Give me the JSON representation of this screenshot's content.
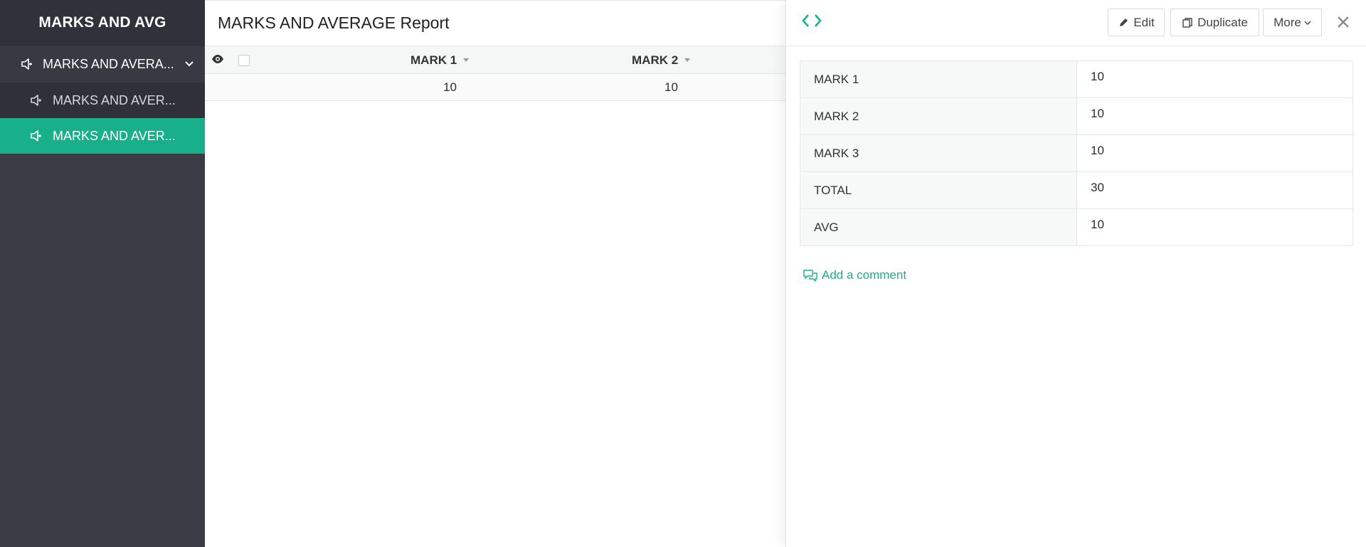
{
  "app": {
    "title": "MARKS AND AVG"
  },
  "sidebar": {
    "group": {
      "label": "MARKS AND AVERA..."
    },
    "items": [
      {
        "label": "MARKS AND AVER...",
        "active": false
      },
      {
        "label": "MARKS AND AVER...",
        "active": true
      }
    ]
  },
  "report": {
    "title": "MARKS AND AVERAGE Report",
    "columns": [
      "MARK 1",
      "MARK 2"
    ],
    "rows": [
      [
        "10",
        "10"
      ]
    ]
  },
  "detail": {
    "buttons": {
      "edit": "Edit",
      "duplicate": "Duplicate",
      "more": "More"
    },
    "fields": [
      {
        "label": "MARK 1",
        "value": "10"
      },
      {
        "label": "MARK 2",
        "value": "10"
      },
      {
        "label": "MARK 3",
        "value": "10"
      },
      {
        "label": "TOTAL",
        "value": "30"
      },
      {
        "label": "AVG",
        "value": "10"
      }
    ],
    "add_comment": "Add a comment"
  },
  "colors": {
    "accent": "#17b08a",
    "sidebar_bg": "#3a3b44",
    "sidebar_title_bg": "#30313a",
    "sidebar_item_bg": "#2f3038"
  },
  "icons": {
    "nav": "speaker-icon",
    "group_toggle": "chevron-down-icon",
    "grid_view": "eye-icon",
    "record_nav": "prev-next-arrows-icon",
    "edit": "pencil-icon",
    "duplicate": "duplicate-icon",
    "more": "chevron-down-icon",
    "close": "close-icon",
    "comment": "comment-icon"
  }
}
